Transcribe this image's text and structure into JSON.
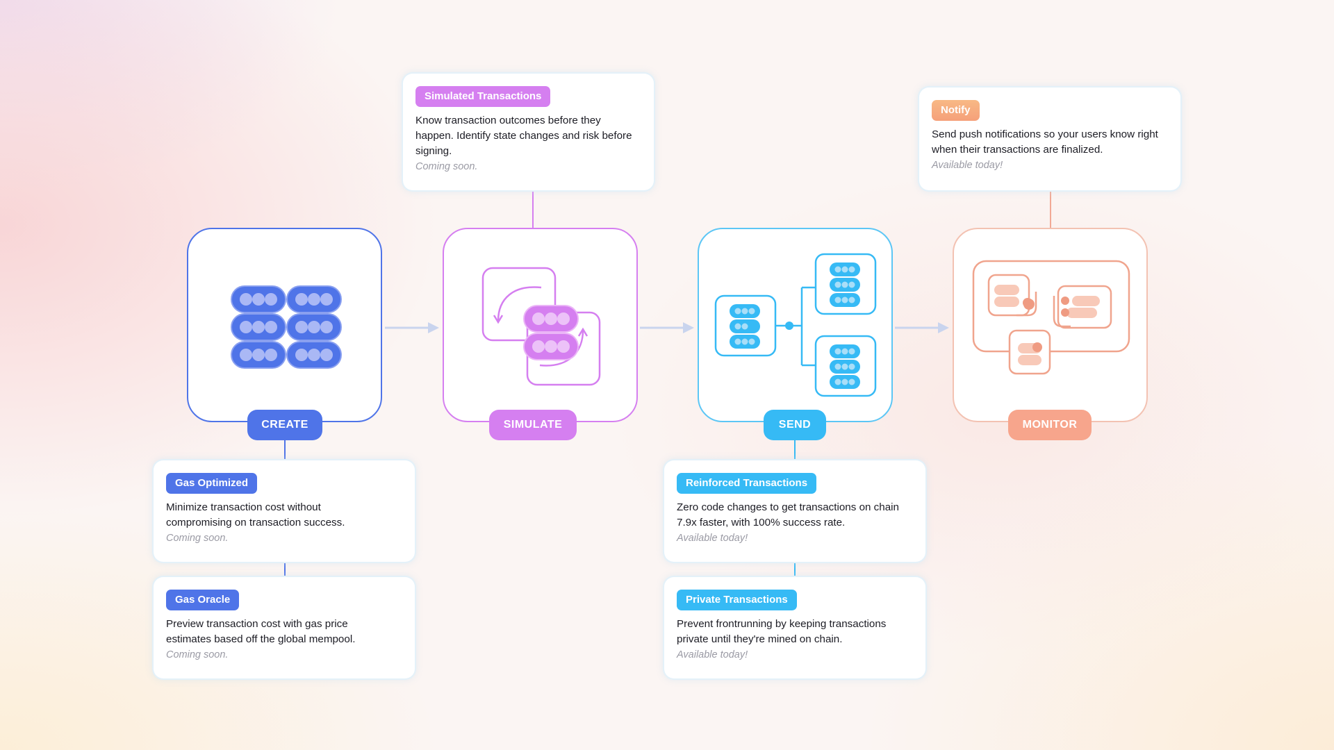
{
  "stages": [
    {
      "id": "create",
      "label": "CREATE",
      "icon": "grid-of-records-icon",
      "color": "#4f74e8"
    },
    {
      "id": "simulate",
      "label": "SIMULATE",
      "icon": "simulation-cycle-icon",
      "color": "#d57ff0"
    },
    {
      "id": "send",
      "label": "SEND",
      "icon": "broadcast-branch-icon",
      "color": "#36baf5"
    },
    {
      "id": "monitor",
      "label": "MONITOR",
      "icon": "monitoring-windows-icon",
      "color": "#f7a58c"
    }
  ],
  "features": {
    "simulated": {
      "badge": "Simulated Transactions",
      "description": "Know transaction outcomes before they happen. Identify state changes and risk before signing.",
      "status": "Coming soon.",
      "color": "#d57ff0"
    },
    "notify": {
      "badge": "Notify",
      "description": "Send push notifications so your users know right when their transactions are finalized.",
      "status": "Available today!",
      "color": "#f7b07f"
    },
    "gas_optimized": {
      "badge": "Gas Optimized",
      "description": "Minimize transaction cost without compromising on transaction success.",
      "status": "Coming soon.",
      "color": "#4f74e8"
    },
    "gas_oracle": {
      "badge": "Gas Oracle",
      "description": "Preview transaction cost with gas price estimates based off the global mempool.",
      "status": "Coming soon.",
      "color": "#4f74e8"
    },
    "reinforced": {
      "badge": "Reinforced Transactions",
      "description": "Zero code changes to get transactions on chain 7.9x faster, with 100% success rate.",
      "status": "Available today!",
      "color": "#36baf5"
    },
    "private": {
      "badge": "Private Transactions",
      "description": "Prevent frontrunning by keeping transactions private until they're mined on chain.",
      "status": "Available today!",
      "color": "#36baf5"
    }
  },
  "connector_color": "#c9d4ee"
}
